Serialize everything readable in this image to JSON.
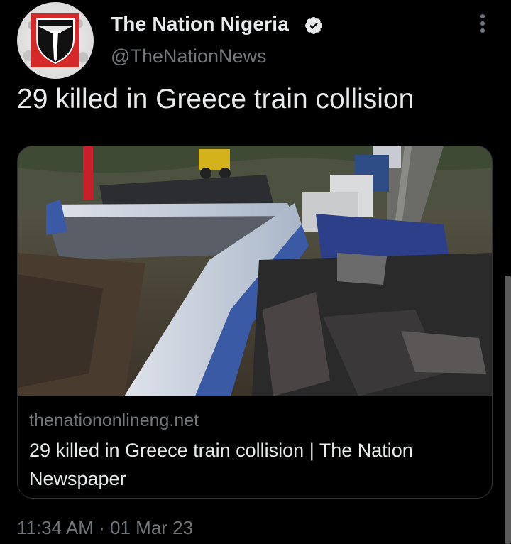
{
  "account": {
    "display_name": "The Nation Nigeria",
    "handle": "@TheNationNews",
    "verified": true
  },
  "tweet": {
    "text": "29 killed in Greece train collision",
    "timestamp": "11:34 AM · 01 Mar 23"
  },
  "link_card": {
    "domain": "thenationonlineng.net",
    "title": "29 killed in Greece train collision | The Nation Newspaper"
  },
  "icons": [
    "avatar-logo",
    "verified-badge-icon",
    "more-options-icon"
  ],
  "colors": {
    "background": "#000000",
    "primary_text": "#e7e9ea",
    "secondary_text": "#71767b",
    "card_border": "#2f3336",
    "logo_red": "#d62828"
  }
}
